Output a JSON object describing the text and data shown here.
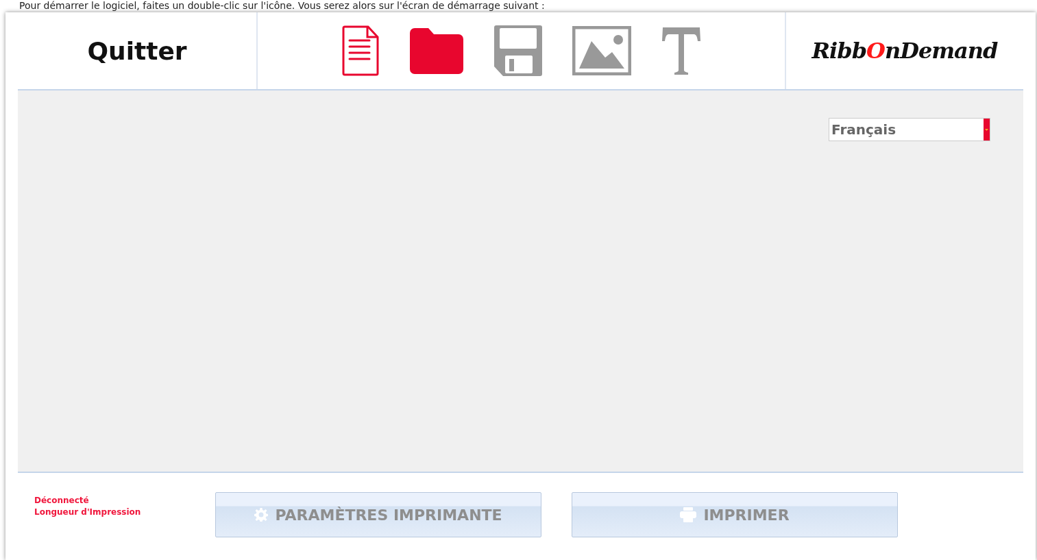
{
  "caption": "Pour démarrer le logiciel, faites un double-clic sur l'icône. Vous serez alors sur l'écran de démarrage suivant :",
  "header": {
    "quit_label": "Quitter",
    "tools": [
      {
        "kind": "document",
        "color": "#e8062e"
      },
      {
        "kind": "folder",
        "color": "#e8062e"
      },
      {
        "kind": "save",
        "color": "#999999"
      },
      {
        "kind": "image",
        "color": "#999999"
      },
      {
        "kind": "text",
        "color": "#999999"
      }
    ],
    "logo": [
      {
        "text": "Ribb",
        "accent": false
      },
      {
        "text": "O",
        "accent": true
      },
      {
        "text": "nDemand",
        "accent": false
      }
    ]
  },
  "language_select": {
    "value": "Français"
  },
  "footer": {
    "status_lines": [
      "Déconnecté",
      "Longueur d'Impression"
    ],
    "buttons": [
      {
        "kind": "settings",
        "label": "PARAMÈTRES IMPRIMANTE"
      },
      {
        "kind": "print",
        "label": "IMPRIMER"
      }
    ]
  }
}
